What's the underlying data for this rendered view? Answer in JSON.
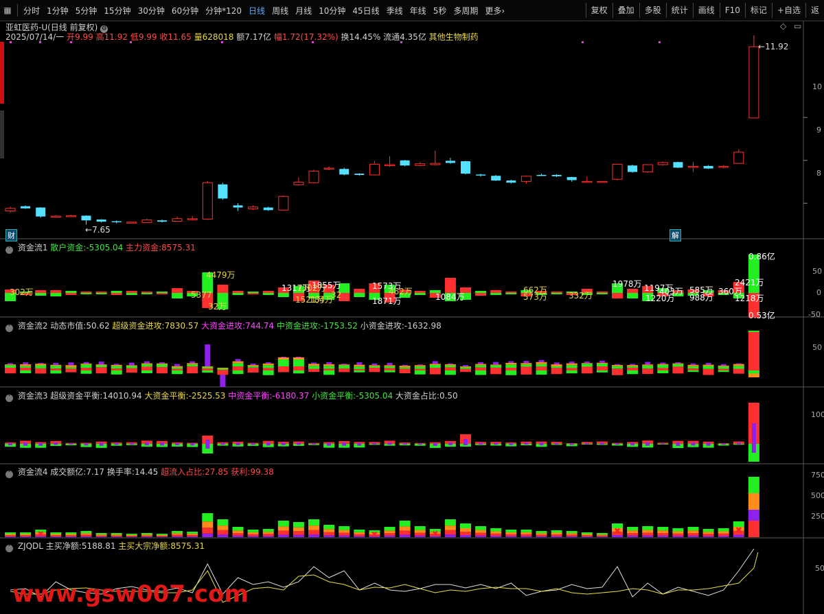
{
  "toolbar": {
    "items": [
      "分时",
      "1分钟",
      "5分钟",
      "15分钟",
      "30分钟",
      "60分钟",
      "分钟*120",
      "日线",
      "周线",
      "月线",
      "10分钟",
      "45日线",
      "季线",
      "年线",
      "5秒",
      "多周期",
      "更多"
    ],
    "active": "日线",
    "right_items": [
      "复权",
      "叠加",
      "多股",
      "统计",
      "画线",
      "F10",
      "标记",
      "+自选",
      "返"
    ]
  },
  "header": {
    "title": "亚虹医药-U(日线 前复权)",
    "date": "2025/07/14/一",
    "open_label": "开",
    "open": "9.99",
    "high_label": "高",
    "high": "11.92",
    "low_label": "低",
    "low": "9.99",
    "close_label": "收",
    "close": "11.65",
    "vol_label": "量",
    "vol": "628018",
    "amt_label": "额",
    "amt": "7.17亿",
    "chg_label": "幅",
    "chg": "1.72(17.32%)",
    "turnover": "换14.45%",
    "float_cap": "流通4.35亿",
    "industry": "其他生物制药"
  },
  "price_panel": {
    "marker_cai": "财",
    "marker_jie": "解",
    "high_annot": "11.92",
    "low_annot": "7.65",
    "y_ticks": [
      "10",
      "9",
      "8"
    ]
  },
  "panels": {
    "p1": {
      "name": "资金流1",
      "a_label": "散户资金:",
      "a_val": "-5305.04",
      "b_label": "主力资金:",
      "b_val": "8575.31",
      "annots": [
        {
          "t": "302万",
          "c": "#e8d64a"
        },
        {
          "t": "4479万",
          "c": "#e8d64a"
        },
        {
          "t": "5377",
          "c": "#e8d64a"
        },
        {
          "t": "32万",
          "c": "#e8d64a"
        },
        {
          "t": "1317万",
          "c": "#fff"
        },
        {
          "t": "1302万",
          "c": "#e8d64a"
        },
        {
          "t": "1855万",
          "c": "#fff"
        },
        {
          "t": "1521万",
          "c": "#e8d64a"
        },
        {
          "t": "184万",
          "c": "#e8d64a"
        },
        {
          "t": "32",
          "c": "#e8d64a"
        },
        {
          "t": "1573万",
          "c": "#fff"
        },
        {
          "t": "1871万",
          "c": "#fff"
        },
        {
          "t": "462万",
          "c": "#e8d64a"
        },
        {
          "t": "1084万",
          "c": "#fff"
        },
        {
          "t": "662万",
          "c": "#e8d64a"
        },
        {
          "t": "573万",
          "c": "#e8d64a"
        },
        {
          "t": "332万",
          "c": "#e8d64a"
        },
        {
          "t": "1978万",
          "c": "#fff"
        },
        {
          "t": "1197万",
          "c": "#fff"
        },
        {
          "t": "1220万",
          "c": "#fff"
        },
        {
          "t": "403万",
          "c": "#fff"
        },
        {
          "t": "585万",
          "c": "#fff"
        },
        {
          "t": "988万",
          "c": "#fff"
        },
        {
          "t": "360万",
          "c": "#fff"
        },
        {
          "t": "2421万",
          "c": "#fff"
        },
        {
          "t": "1218万",
          "c": "#fff"
        },
        {
          "t": "0.86亿",
          "c": "#fff"
        },
        {
          "t": "0.53亿",
          "c": "#fff"
        }
      ],
      "y_ticks": [
        "50",
        "0",
        "-50"
      ]
    },
    "p2": {
      "name": "资金流2",
      "a_label": "动态市值:",
      "a_val": "50.62",
      "b_label": "超级资金进攻:",
      "b_val": "7830.57",
      "c_label": "大资金进攻:",
      "c_val": "744.74",
      "d_label": "中资金进攻:",
      "d_val": "-1753.52",
      "e_label": "小资金进攻:",
      "e_val": "-1632.98",
      "y_ticks": [
        "50"
      ]
    },
    "p3": {
      "name": "资金流3",
      "a_label": "超级资金平衡:",
      "a_val": "14010.94",
      "b_label": "大资金平衡:",
      "b_val": "-2525.53",
      "c_label": "中资金平衡:",
      "c_val": "-6180.37",
      "d_label": "小资金平衡:",
      "d_val": "-5305.04",
      "e_label": "大资金占比:",
      "e_val": "0.50",
      "y_ticks": [
        "100"
      ]
    },
    "p4": {
      "name": "资金流4",
      "a_label": "成交额亿:",
      "a_val": "7.17",
      "b_label": "换手率:",
      "b_val": "14.45",
      "c_label": "超流入占比:",
      "c_val": "27.85",
      "d_label": "获利:",
      "d_val": "99.38",
      "y_ticks": [
        "750",
        "500",
        "250"
      ]
    },
    "p5": {
      "name": "ZJQDL",
      "a_label": "主买净额:",
      "a_val": "5188.81",
      "b_label": "主买大宗净额:",
      "b_val": "8575.31",
      "y_ticks": [
        "50"
      ]
    }
  },
  "watermark": "www.gsw007.com",
  "colors": {
    "up": "#ff3030",
    "down": "#54e0ff",
    "green": "#22ee22",
    "purple": "#9020ee",
    "orange": "#ff8c1a",
    "yellow": "#e8e040",
    "white": "#e0e0e0"
  },
  "chart_data": [
    {
      "type": "candlestick",
      "title": "亚虹医药-U(日线 前复权)",
      "candles": [
        {
          "o": 7.82,
          "c": 7.88,
          "h": 7.92,
          "l": 7.78
        },
        {
          "o": 7.93,
          "c": 7.88,
          "h": 7.95,
          "l": 7.87
        },
        {
          "o": 7.9,
          "c": 7.69,
          "h": 7.91,
          "l": 7.66
        },
        {
          "o": 7.69,
          "c": 7.7,
          "h": 7.72,
          "l": 7.67
        },
        {
          "o": 7.7,
          "c": 7.71,
          "h": 7.73,
          "l": 7.68
        },
        {
          "o": 7.71,
          "c": 7.6,
          "h": 7.72,
          "l": 7.5
        },
        {
          "o": 7.62,
          "c": 7.57,
          "h": 7.63,
          "l": 7.55
        },
        {
          "o": 7.58,
          "c": 7.56,
          "h": 7.6,
          "l": 7.53
        },
        {
          "o": 7.55,
          "c": 7.56,
          "h": 7.57,
          "l": 7.53
        },
        {
          "o": 7.55,
          "c": 7.61,
          "h": 7.64,
          "l": 7.54
        },
        {
          "o": 7.6,
          "c": 7.57,
          "h": 7.62,
          "l": 7.55
        },
        {
          "o": 7.58,
          "c": 7.64,
          "h": 7.69,
          "l": 7.57
        },
        {
          "o": 7.64,
          "c": 7.64,
          "h": 7.7,
          "l": 7.6
        },
        {
          "o": 7.63,
          "c": 8.48,
          "h": 8.52,
          "l": 7.61
        },
        {
          "o": 8.44,
          "c": 8.11,
          "h": 8.48,
          "l": 8.08
        },
        {
          "o": 7.95,
          "c": 7.9,
          "h": 8.0,
          "l": 7.82
        },
        {
          "o": 7.87,
          "c": 7.91,
          "h": 7.95,
          "l": 7.84
        },
        {
          "o": 7.9,
          "c": 7.84,
          "h": 7.92,
          "l": 7.82
        },
        {
          "o": 7.84,
          "c": 8.16,
          "h": 8.18,
          "l": 7.83
        },
        {
          "o": 8.43,
          "c": 8.49,
          "h": 8.6,
          "l": 8.41
        },
        {
          "o": 8.48,
          "c": 8.75,
          "h": 8.78,
          "l": 8.46
        },
        {
          "o": 8.8,
          "c": 8.82,
          "h": 8.86,
          "l": 8.77
        },
        {
          "o": 8.8,
          "c": 8.67,
          "h": 8.83,
          "l": 8.65
        },
        {
          "o": 8.69,
          "c": 8.66,
          "h": 8.7,
          "l": 8.64
        },
        {
          "o": 8.66,
          "c": 8.91,
          "h": 8.98,
          "l": 8.65
        },
        {
          "o": 8.9,
          "c": 8.9,
          "h": 9.1,
          "l": 8.85
        },
        {
          "o": 9.0,
          "c": 8.88,
          "h": 9.01,
          "l": 8.86
        },
        {
          "o": 8.88,
          "c": 8.92,
          "h": 8.96,
          "l": 8.86
        },
        {
          "o": 8.9,
          "c": 8.93,
          "h": 9.23,
          "l": 8.88
        },
        {
          "o": 8.99,
          "c": 8.94,
          "h": 9.06,
          "l": 8.92
        },
        {
          "o": 8.98,
          "c": 8.69,
          "h": 8.99,
          "l": 8.67
        },
        {
          "o": 8.67,
          "c": 8.66,
          "h": 8.69,
          "l": 8.62
        },
        {
          "o": 8.64,
          "c": 8.53,
          "h": 8.66,
          "l": 8.52
        },
        {
          "o": 8.53,
          "c": 8.48,
          "h": 8.55,
          "l": 8.46
        },
        {
          "o": 8.51,
          "c": 8.63,
          "h": 8.65,
          "l": 8.45
        },
        {
          "o": 8.66,
          "c": 8.65,
          "h": 8.69,
          "l": 8.64
        },
        {
          "o": 8.66,
          "c": 8.63,
          "h": 8.68,
          "l": 8.61
        },
        {
          "o": 8.61,
          "c": 8.54,
          "h": 8.62,
          "l": 8.5
        },
        {
          "o": 8.5,
          "c": 8.51,
          "h": 8.62,
          "l": 8.49
        },
        {
          "o": 8.5,
          "c": 8.51,
          "h": 8.52,
          "l": 8.48
        },
        {
          "o": 8.56,
          "c": 8.91,
          "h": 8.92,
          "l": 8.53
        },
        {
          "o": 8.88,
          "c": 8.73,
          "h": 8.9,
          "l": 8.71
        },
        {
          "o": 8.73,
          "c": 8.9,
          "h": 8.91,
          "l": 8.71
        },
        {
          "o": 8.9,
          "c": 8.95,
          "h": 8.97,
          "l": 8.88
        },
        {
          "o": 8.96,
          "c": 8.83,
          "h": 8.97,
          "l": 8.82
        },
        {
          "o": 8.85,
          "c": 8.86,
          "h": 8.96,
          "l": 8.73
        },
        {
          "o": 8.87,
          "c": 8.81,
          "h": 8.89,
          "l": 8.8
        },
        {
          "o": 8.84,
          "c": 8.86,
          "h": 8.89,
          "l": 8.81
        },
        {
          "o": 8.93,
          "c": 9.19,
          "h": 9.26,
          "l": 8.92
        },
        {
          "o": 9.99,
          "c": 11.65,
          "h": 11.92,
          "l": 9.99
        }
      ],
      "y_ticks": [
        8,
        9,
        10
      ]
    }
  ]
}
